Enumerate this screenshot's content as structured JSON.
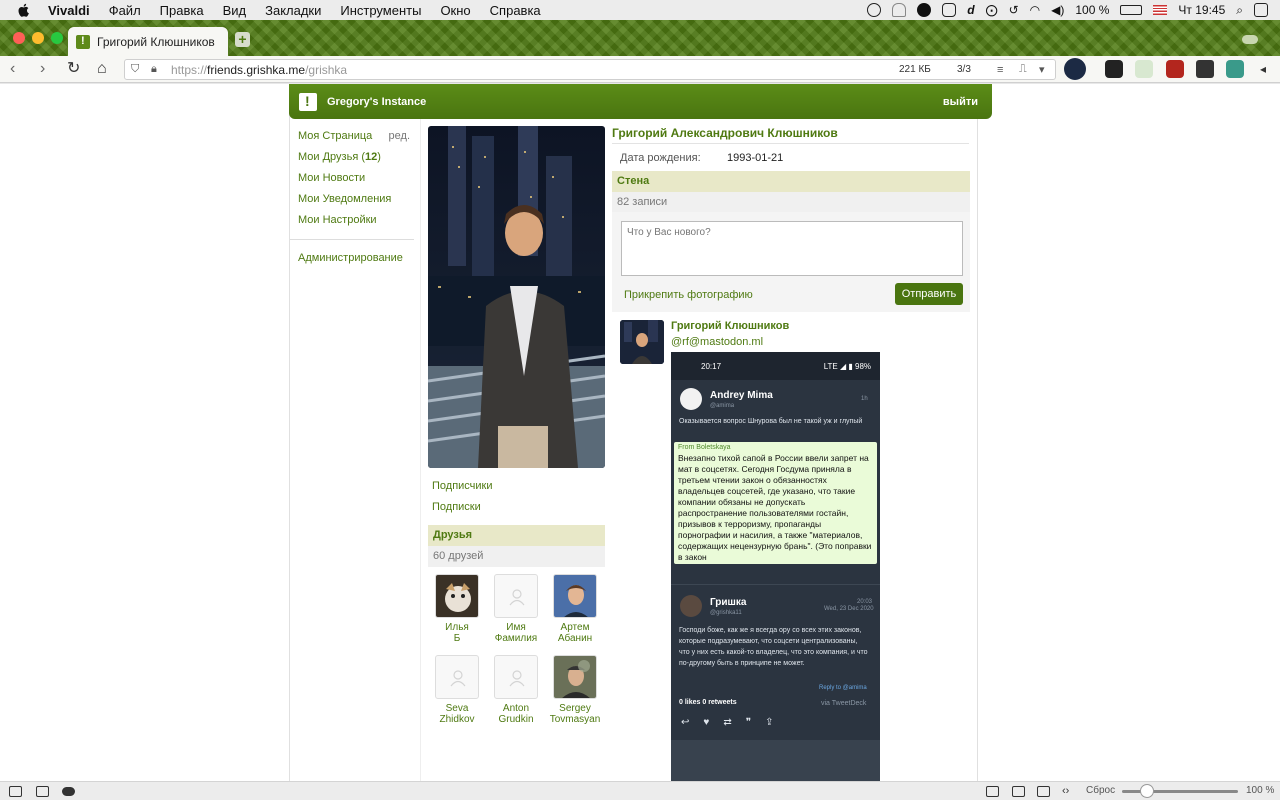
{
  "menubar": {
    "app": "Vivaldi",
    "items": [
      "Файл",
      "Правка",
      "Вид",
      "Закладки",
      "Инструменты",
      "Окно",
      "Справка"
    ],
    "battery": "100 %",
    "clock": "Чт 19:45"
  },
  "tab": {
    "title": "Григорий Клюшников"
  },
  "address": {
    "protocol": "https://",
    "host": "friends.grishka.me",
    "path": "/grishka",
    "size": "221 КБ",
    "count": "3/3"
  },
  "site": {
    "brand": "Gregory's Instance",
    "logout": "выйти"
  },
  "sidebar": {
    "my_page": "Моя Страница",
    "edit": "ред.",
    "friends_label": "Мои Друзья (",
    "friends_count": "12",
    "friends_close": ")",
    "news": "Мои Новости",
    "notifications": "Мои Уведомления",
    "settings": "Мои Настройки",
    "admin": "Администрирование"
  },
  "profile": {
    "name": "Григорий Александрович Клюшников",
    "birth_label": "Дата рождения:",
    "birth_value": "1993-01-21",
    "followers": "Подписчики",
    "following": "Подписки"
  },
  "friends_box": {
    "title": "Друзья",
    "count": "60 друзей",
    "list": [
      {
        "first": "Илья",
        "last": "Б"
      },
      {
        "first": "Имя",
        "last": "Фамилия"
      },
      {
        "first": "Артем",
        "last": "Абанин"
      },
      {
        "first": "Seva",
        "last": "Zhidkov"
      },
      {
        "first": "Anton",
        "last": "Grudkin"
      },
      {
        "first": "Sergey",
        "last": "Tovmasyan"
      }
    ]
  },
  "wall": {
    "title": "Стена",
    "count": "82 записи",
    "placeholder": "Что у Вас нового?",
    "attach": "Прикрепить фотографию",
    "send": "Отправить"
  },
  "post": {
    "author": "Григорий Клюшников",
    "handle": "@rf@mastodon.ml",
    "screenshot": {
      "time": "20:17",
      "signal": "LTE ◢ ▮ 98%",
      "tweet1_name": "Andrey Mima",
      "tweet1_handle": "@amima",
      "tweet1_age": "1h",
      "tweet1_text": "Оказывается вопрос Шнурова был не такой уж и глупый",
      "quote_from": "From Boletskaya",
      "quote_text": "Внезапно тихой сапой в России ввели запрет на мат в соцсетях. Сегодня Госдума приняла в третьем чтении закон о обязанностях владельцев соцсетей, где указано, что такие компании обязаны не допускать распространение пользователями гостайн, призывов к терроризму, пропаганды порнографии и насилия, а также \"материалов, содержащих нецензурную брань\". (Это поправки в закон",
      "tweet2_name": "Гришка",
      "tweet2_handle": "@grishka11",
      "tweet2_time": "20:03",
      "tweet2_date": "Wed, 23 Dec 2020",
      "tweet2_text": "Господи боже, как же я всегда ору со всех этих законов, которые подразумевают, что соцсети централизованы, что у них есть какой-то владелец, что это компания, и что по-другому быть в принципе не может.",
      "reply_to": "Reply to @amima",
      "likes": "0 likes 0 retweets",
      "via": "via TweetDeck"
    }
  },
  "statusbar": {
    "reset": "Сброс",
    "zoom": "100 %",
    "zoom_level": 1.0
  },
  "colors": {
    "accent": "#4f7a12",
    "header": "#5b8c17"
  }
}
